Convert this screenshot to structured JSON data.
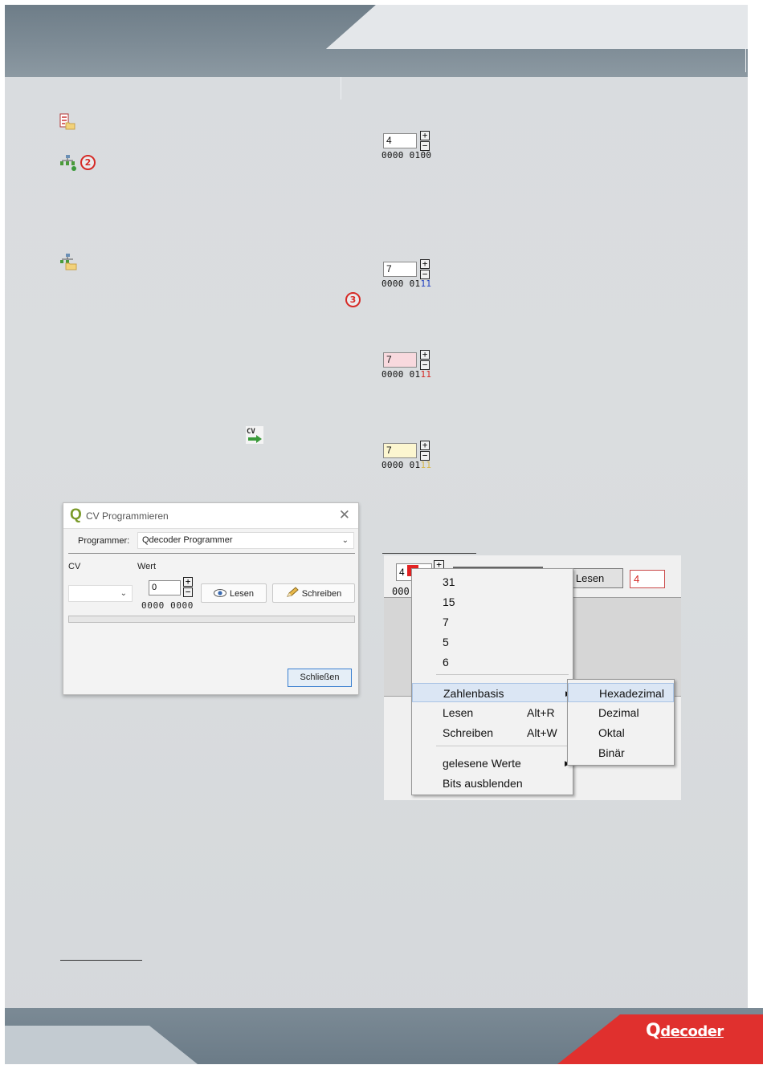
{
  "header": {},
  "badges": {
    "two": "2",
    "three": "3"
  },
  "icons": {
    "list_icon": "cv-list-icon",
    "network_icon": "decoder-network-icon",
    "network_folder_icon": "decoder-folder-icon",
    "cv_icon": "cv-write-icon",
    "cv_icon_label": "CV"
  },
  "spins": [
    {
      "value": "4",
      "bits_prefix": "0000 0100",
      "bits_hi": "",
      "bg": "#ffffff",
      "hi_class": ""
    },
    {
      "value": "7",
      "bits_prefix": "0000 01",
      "bits_hi": "11",
      "bg": "#ffffff",
      "hi_class": "hi-blue"
    },
    {
      "value": "7",
      "bits_prefix": "0000 01",
      "bits_hi": "11",
      "bg": "#f8d9de",
      "hi_class": "hi-red"
    },
    {
      "value": "7",
      "bits_prefix": "0000 01",
      "bits_hi": "11",
      "bg": "#fcf6d0",
      "hi_class": "hi-yellow"
    }
  ],
  "dialog": {
    "icon_letter": "Q",
    "title": "CV Programmieren",
    "close_glyph": "✕",
    "programmer_label": "Programmer:",
    "programmer_value": "Qdecoder Programmer",
    "cv_label": "CV",
    "wert_label": "Wert",
    "cv_value": "",
    "wert_value": "0",
    "wert_bits": "0000 0000",
    "lesen": "Lesen",
    "schreiben": "Schreiben",
    "schliessen": "Schließen"
  },
  "context_shot": {
    "input_value": "4",
    "bits_partial": "000",
    "lesen": "Lesen",
    "read_value": "4",
    "menu_items": [
      {
        "label": "31"
      },
      {
        "label": "15"
      },
      {
        "label": "7"
      },
      {
        "label": "5"
      },
      {
        "label": "6"
      }
    ],
    "zahlenbasis": "Zahlenbasis",
    "lesen_item": "Lesen",
    "lesen_shortcut": "Alt+R",
    "schreiben_item": "Schreiben",
    "schreiben_shortcut": "Alt+W",
    "gelesene": "gelesene Werte",
    "bits_ausblenden": "Bits ausblenden",
    "submenu": [
      "Hexadezimal",
      "Dezimal",
      "Oktal",
      "Binär"
    ]
  },
  "brand": {
    "q": "Q",
    "rest": "decoder"
  }
}
